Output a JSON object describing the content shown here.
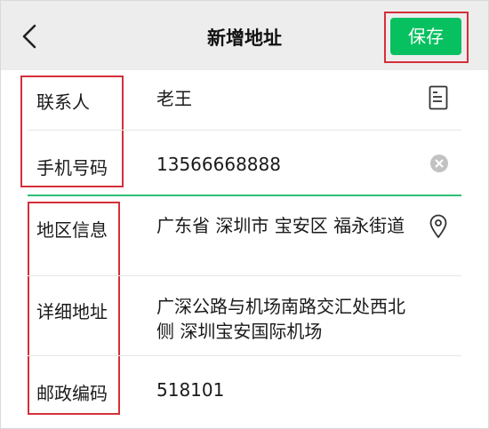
{
  "header": {
    "title": "新增地址",
    "save_label": "保存"
  },
  "form": {
    "contact": {
      "label": "联系人",
      "value": "老王"
    },
    "phone": {
      "label": "手机号码",
      "value": "13566668888"
    },
    "region": {
      "label": "地区信息",
      "value": "广东省 深圳市 宝安区 福永街道"
    },
    "detail": {
      "label": "详细地址",
      "value": "广深公路与机场南路交汇处西北侧 深圳宝安国际机场"
    },
    "postal": {
      "label": "邮政编码",
      "value": "518101"
    }
  },
  "icons": {
    "back": "back-chevron-icon",
    "contact_book": "contact-list-icon",
    "clear": "clear-circle-icon",
    "location": "location-pin-icon"
  },
  "colors": {
    "accent_green": "#07c160",
    "highlight_red": "#d3303a",
    "header_bg": "#ededed"
  }
}
